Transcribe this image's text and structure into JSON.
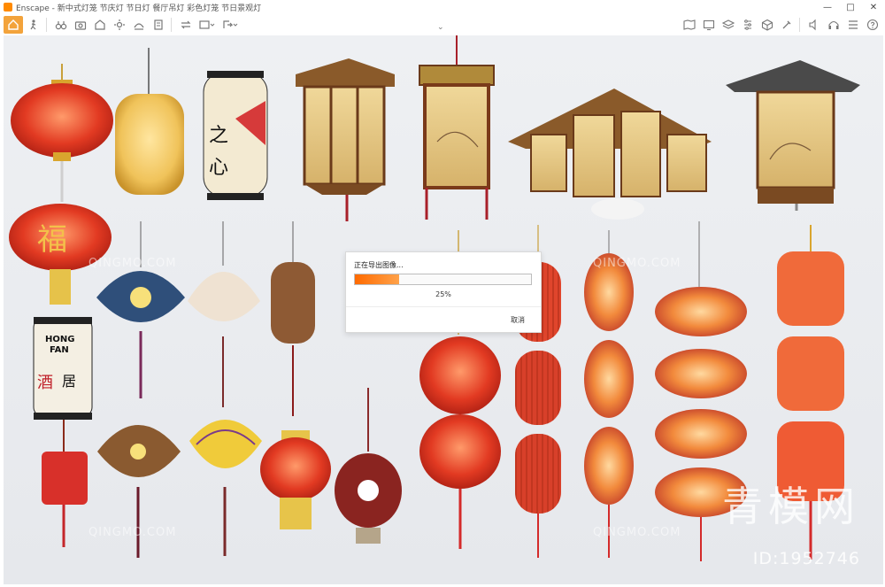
{
  "window": {
    "title": "Enscape - 新中式灯笼 节庆灯 节日灯 餐厅吊灯 彩色灯笼 节日景观灯",
    "controls": {
      "minimize": "—",
      "maximize": "□",
      "close": "✕"
    }
  },
  "toolbar": {
    "left_icons": [
      "home-icon",
      "walk-icon",
      "binoculars-icon",
      "camera-icon",
      "house-icon",
      "sun-icon",
      "sky-icon",
      "book-icon",
      "sync-icon",
      "views-icon",
      "export-icon"
    ],
    "right_icons": [
      "map-icon",
      "screen-icon",
      "layers-icon",
      "settings-icon",
      "cube-icon",
      "tools-icon",
      "sound-icon",
      "headset-icon",
      "asset-library-icon",
      "help-icon"
    ],
    "accent": "#f3a33b"
  },
  "export_dialog": {
    "title": "正在导出图像...",
    "progress": 0.25,
    "percent_label": "25%",
    "cancel_label": "取消",
    "bar_color": "#ff7a1a"
  },
  "watermarks": {
    "repeated": "QINGMO.COM",
    "brand": "青模网",
    "id": "ID:1952746"
  }
}
